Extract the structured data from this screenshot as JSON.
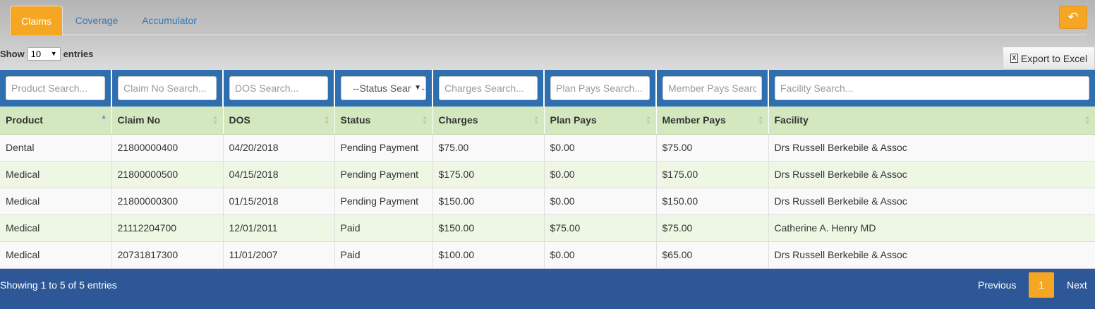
{
  "tabs": [
    {
      "label": "Claims",
      "active": true
    },
    {
      "label": "Coverage",
      "active": false
    },
    {
      "label": "Accumulator",
      "active": false
    }
  ],
  "back_button_icon": "reply-arrow-icon",
  "length": {
    "show_label": "Show",
    "value": "10",
    "entries_label": "entries"
  },
  "export": {
    "label": "Export to Excel",
    "icon": "excel-icon"
  },
  "filters": {
    "product": "Product Search...",
    "claim_no": "Claim No Search...",
    "dos": "DOS Search...",
    "status": "--Status Search--",
    "charges": "Charges Search...",
    "plan_pays": "Plan Pays Search...",
    "member_pays": "Member Pays Search...",
    "facility": "Facility Search..."
  },
  "columns": [
    "Product",
    "Claim No",
    "DOS",
    "Status",
    "Charges",
    "Plan Pays",
    "Member Pays",
    "Facility"
  ],
  "rows": [
    [
      "Dental",
      "21800000400",
      "04/20/2018",
      "Pending Payment",
      "$75.00",
      "$0.00",
      "$75.00",
      "Drs Russell Berkebile & Assoc"
    ],
    [
      "Medical",
      "21800000500",
      "04/15/2018",
      "Pending Payment",
      "$175.00",
      "$0.00",
      "$175.00",
      "Drs Russell Berkebile & Assoc"
    ],
    [
      "Medical",
      "21800000300",
      "01/15/2018",
      "Pending Payment",
      "$150.00",
      "$0.00",
      "$150.00",
      "Drs Russell Berkebile & Assoc"
    ],
    [
      "Medical",
      "21112204700",
      "12/01/2011",
      "Paid",
      "$150.00",
      "$75.00",
      "$75.00",
      "Catherine A. Henry MD"
    ],
    [
      "Medical",
      "20731817300",
      "11/01/2007",
      "Paid",
      "$100.00",
      "$0.00",
      "$65.00",
      "Drs Russell Berkebile & Assoc"
    ]
  ],
  "footer": {
    "info": "Showing 1 to 5 of 5 entries",
    "previous": "Previous",
    "page": "1",
    "next": "Next"
  },
  "colors": {
    "accent": "#f5a623",
    "filter_bar": "#2f6fb0",
    "header_row": "#d3e8bf",
    "footer": "#2d5797"
  }
}
